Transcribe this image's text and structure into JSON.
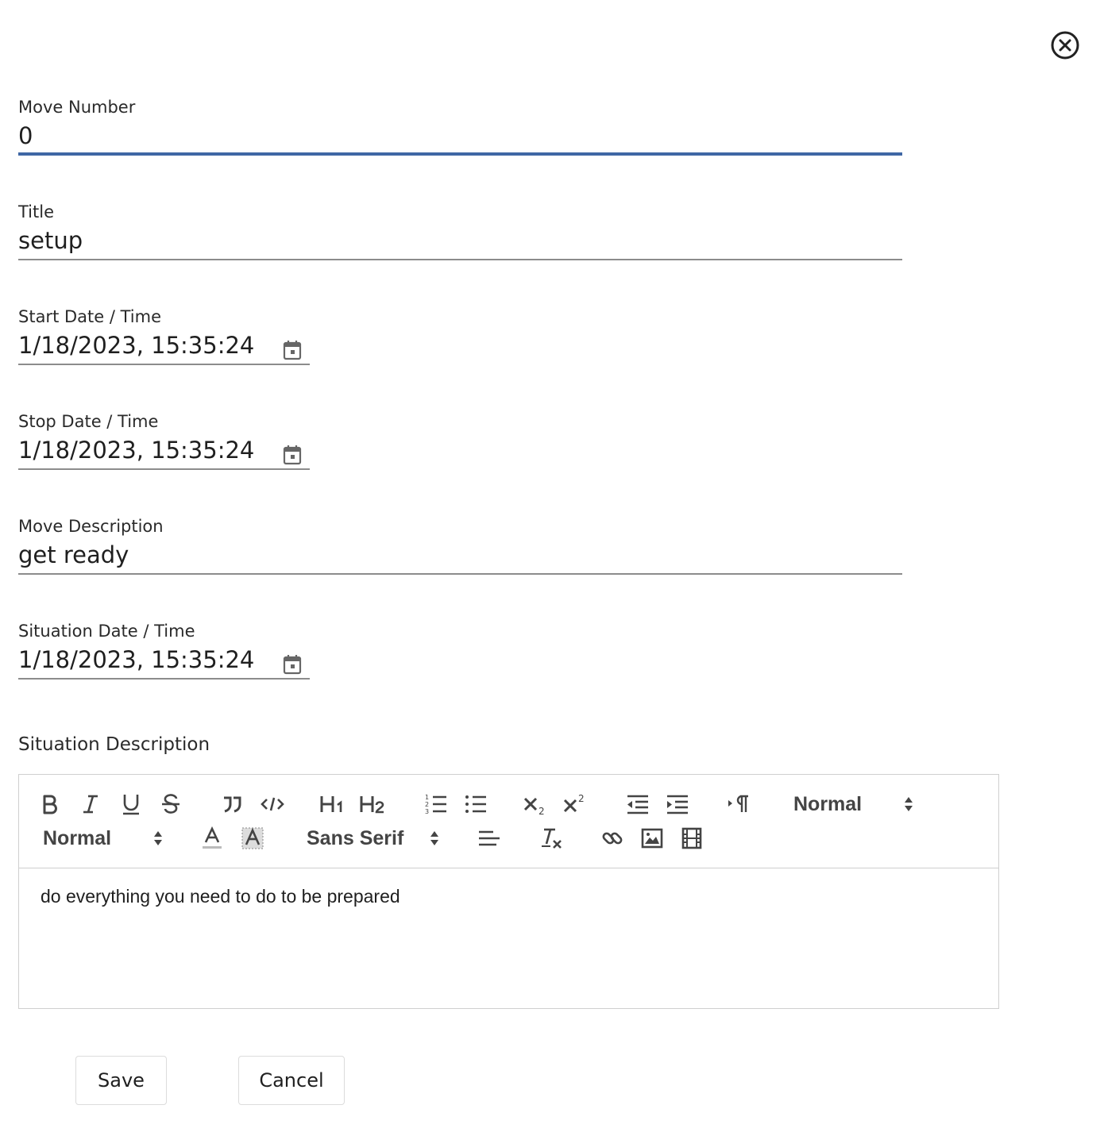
{
  "dialog": {
    "close_icon": "close-circle-icon"
  },
  "fields": {
    "move_number": {
      "label": "Move Number",
      "value": "0"
    },
    "title": {
      "label": "Title",
      "value": "setup"
    },
    "start": {
      "label": "Start Date / Time",
      "value": "1/18/2023, 15:35:24",
      "icon": "calendar-icon"
    },
    "stop": {
      "label": "Stop Date / Time",
      "value": "1/18/2023, 15:35:24",
      "icon": "calendar-icon"
    },
    "move_description": {
      "label": "Move Description",
      "value": "get ready"
    },
    "situation_time": {
      "label": "Situation Date / Time",
      "value": "1/18/2023, 15:35:24",
      "icon": "calendar-icon"
    }
  },
  "situation_description": {
    "label": "Situation Description",
    "toolbar": {
      "header_select": "Normal",
      "size_select": "Normal",
      "font_select": "Sans Serif",
      "buttons": [
        "bold",
        "italic",
        "underline",
        "strike",
        "blockquote",
        "code-block",
        "header-1",
        "header-2",
        "ordered-list",
        "bullet-list",
        "subscript",
        "superscript",
        "outdent",
        "indent",
        "text-direction",
        "color",
        "background",
        "align",
        "clean",
        "link",
        "image",
        "video"
      ]
    },
    "content": "do everything you need to do to be prepared"
  },
  "actions": {
    "save_label": "Save",
    "cancel_label": "Cancel"
  },
  "colors": {
    "focus_underline": "#3f67a5",
    "underline": "#8c8c8c",
    "border": "#cfcfcf"
  }
}
